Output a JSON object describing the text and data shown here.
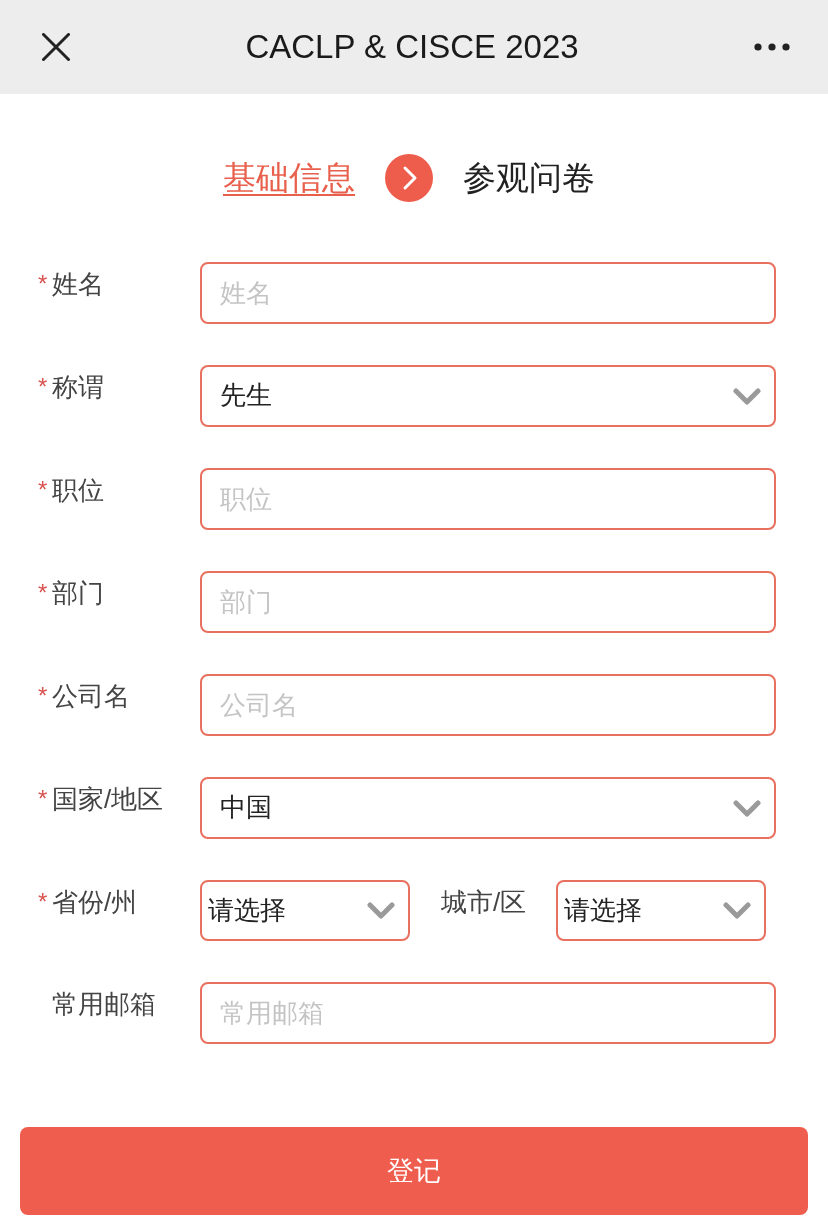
{
  "header": {
    "title": "CACLP & CISCE 2023"
  },
  "steps": [
    {
      "label": "基础信息",
      "selected": true
    },
    {
      "label": "参观问卷",
      "selected": false
    }
  ],
  "fields": [
    {
      "kind": "text",
      "required_mark": "*",
      "label": "姓名",
      "placeholder": "姓名"
    },
    {
      "kind": "select",
      "required_mark": "*",
      "label": "称谓",
      "value": "先生"
    },
    {
      "kind": "text",
      "required_mark": "*",
      "label": "职位",
      "placeholder": "职位"
    },
    {
      "kind": "text",
      "required_mark": "*",
      "label": "部门",
      "placeholder": "部门"
    },
    {
      "kind": "text",
      "required_mark": "*",
      "label": "公司名",
      "placeholder": "公司名"
    },
    {
      "kind": "select",
      "required_mark": "*",
      "label": "国家/地区",
      "value": "中国"
    },
    {
      "kind": "pair",
      "required_mark": "*",
      "label": "省份/州",
      "value": "请选择",
      "second": {
        "label": "城市/区",
        "value": "请选择"
      }
    },
    {
      "kind": "text",
      "label": "常用邮箱",
      "placeholder": "常用邮箱"
    }
  ],
  "submit": {
    "label": "登记"
  }
}
